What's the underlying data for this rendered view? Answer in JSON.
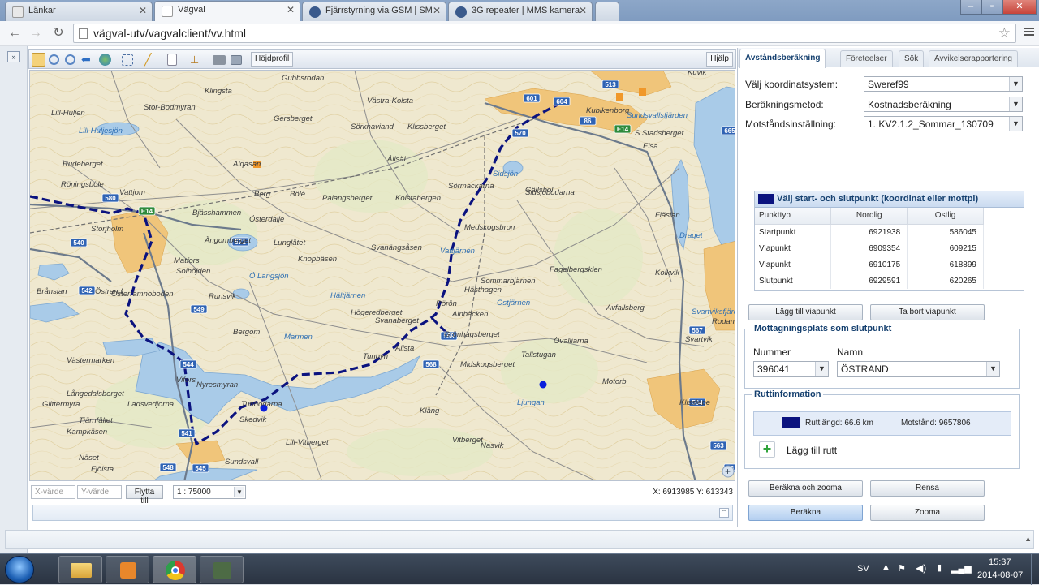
{
  "browser": {
    "tabs": [
      {
        "title": "Länkar",
        "active": false
      },
      {
        "title": "Vägval",
        "active": true
      },
      {
        "title": "Fjärrstyrning via GSM | SM",
        "active": false
      },
      {
        "title": "3G repeater | MMS kamera",
        "active": false
      }
    ],
    "url": "vägval-utv/vagvalclient/vv.html"
  },
  "map": {
    "toolbar_hojdprofil": "Höjdprofil",
    "toolbar_hjalp": "Hjälp",
    "x_placeholder": "X-värde",
    "y_placeholder": "Y-värde",
    "flytta_till": "Flytta till",
    "scale": "1 : 75000",
    "cursor_coords": "X: 6913985  Y: 613343",
    "places": [
      "Gubbsrodan",
      "Klingsta",
      "Västra-Kolsta",
      "Lill-Huljen",
      "Stor-Bodmyran",
      "Lill-Huljesjön",
      "Gersberget",
      "Sörknaviand",
      "Klissberget",
      "Ållsäl",
      "Alqasan",
      "Rudeberget",
      "Röningsböle",
      "Vattjom",
      "Berg",
      "Bölé",
      "Palangsberget",
      "Kolstabergen",
      "Gällsbol",
      "Sörmackarna",
      "Bjässhammen",
      "Österdalje",
      "Storjholm",
      "Ängomberget",
      "Lunglätet",
      "Svanängsåsen",
      "Medskogsbron",
      "Matfors",
      "Solhöjden",
      "Knopbäsen",
      "Vattjärnen",
      "Ö Langsjön",
      "Brånslan",
      "Österrämnoboden",
      "Hältjärnen",
      "Sommarbjärnen",
      "Hästhagen",
      "Rörön",
      "Runsvik",
      "Högeredberget",
      "Östjärnen",
      "Alnbäcken",
      "Bergom",
      "Svanaberget",
      "Allsta",
      "Grönhagsberget",
      "Marmen",
      "Vifors",
      "Tunbyn",
      "Midskogsberget",
      "Tallstugan",
      "Övalliarna",
      "Västermarken",
      "Långedalsberget",
      "Glittermyra",
      "Ladsvedjorna",
      "Tunbodarna",
      "Kläng",
      "Nyresmyran",
      "Tjärnfället",
      "Kampkäsen",
      "Skedvik",
      "Lill-Vitberget",
      "Vitberget",
      "Nasvik",
      "Näset",
      "Fjölsta",
      "Sundsvall",
      "Kubikenborg",
      "Sundsvallsfjärden",
      "Elsa",
      "S Stadsberget",
      "Sidsjöbodarna",
      "Fläsian",
      "Draget",
      "Fagelbergsklen",
      "Kolkvik",
      "Svartviksfjärden",
      "Svartvik",
      "Avfallsberg",
      "Motorb",
      "Klisslepe",
      "Ljungan",
      "Sidsjön",
      "Kuvik",
      "Rodamsberget",
      "Östrand"
    ],
    "road_shields": [
      "513",
      "601",
      "604",
      "86",
      "E14",
      "570",
      "665",
      "580",
      "E14",
      "540",
      "571",
      "542",
      "549",
      "569",
      "568",
      "544",
      "541",
      "545",
      "548",
      "567",
      "564",
      "563",
      "562"
    ]
  },
  "panel": {
    "tabs": [
      "Avståndsberäkning",
      "Företeelser",
      "Sök",
      "Avvikelserapportering"
    ],
    "koordinatsystem_label": "Välj koordinatsystem:",
    "koordinatsystem_value": "Sweref99",
    "metod_label": "Beräkningsmetod:",
    "metod_value": "Kostnadsberäkning",
    "motstand_label": "Motståndsinställning:",
    "motstand_value": "1. KV2.1.2_Sommar_130709",
    "points_title": "Välj start- och slutpunkt (koordinat eller mottpl)",
    "points_headers": [
      "Punkttyp",
      "Nordlig",
      "Ostlig"
    ],
    "points": [
      {
        "typ": "Startpunkt",
        "nordlig": "6921938",
        "ostlig": "586045"
      },
      {
        "typ": "Viapunkt",
        "nordlig": "6909354",
        "ostlig": "609215"
      },
      {
        "typ": "Viapunkt",
        "nordlig": "6910175",
        "ostlig": "618899"
      },
      {
        "typ": "Slutpunkt",
        "nordlig": "6929591",
        "ostlig": "620265"
      }
    ],
    "lagg_till_viapunkt": "Lägg till viapunkt",
    "ta_bort_viapunkt": "Ta bort viapunkt",
    "mottagning_title": "Mottagningsplats som slutpunkt",
    "nummer_label": "Nummer",
    "namn_label": "Namn",
    "nummer_value": "396041",
    "namn_value": "ÖSTRAND",
    "rutt_title": "Ruttinformation",
    "ruttlangd": "Ruttlängd: 66.6 km",
    "motstand": "Motstånd: 9657806",
    "lagg_till_rutt": "Lägg till rutt",
    "berakna_zooma": "Beräkna och zooma",
    "rensa": "Rensa",
    "berakna": "Beräkna",
    "zooma": "Zooma",
    "route_color": "#0b137f"
  },
  "taskbar": {
    "lang": "SV",
    "time": "15:37",
    "date": "2014-08-07"
  }
}
